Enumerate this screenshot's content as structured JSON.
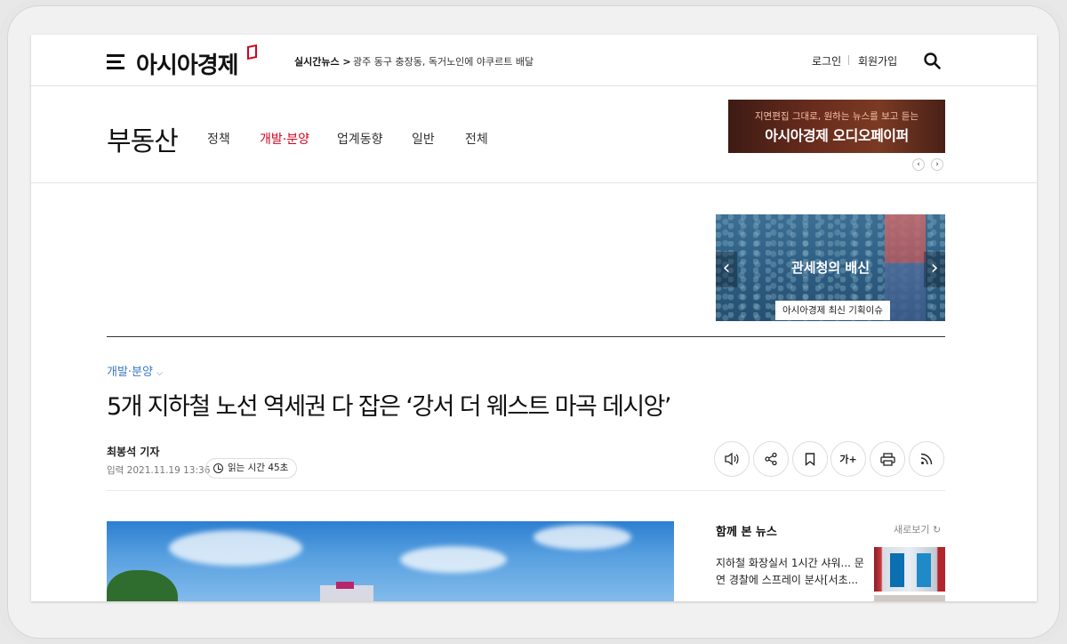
{
  "header": {
    "logo": "아시아경제",
    "live_label": "실시간뉴스 >",
    "live_headline": "광주 동구 충장동, 독거노인에 야쿠르트 배달",
    "login": "로그인",
    "signup": "회원가입"
  },
  "section": {
    "title": "부동산",
    "nav": [
      {
        "label": "정책"
      },
      {
        "label": "개발·분양"
      },
      {
        "label": "업계동향"
      },
      {
        "label": "일반"
      },
      {
        "label": "전체"
      }
    ],
    "active_nav": "개발·분양",
    "banner_sub": "지면편집 그대로, 원하는 뉴스를 보고 듣는",
    "banner_main": "아시아경제 오디오페이퍼"
  },
  "promo": {
    "title": "관세청의 배신",
    "caption": "아시아경제 최신 기획이슈"
  },
  "article": {
    "category": "개발·분양",
    "headline": "5개 지하철 노선 역세권 다 잡은 ‘강서 더 웨스트 마곡 데시앙’",
    "reporter": "최봉석 기자",
    "date": "입력 2021.11.19 13:36",
    "read_time": "읽는 시간 45초",
    "font_size_label": "가+",
    "tools": [
      "speaker-icon",
      "share-icon",
      "bookmark-icon",
      "font-size-button",
      "print-icon",
      "rss-icon"
    ]
  },
  "side_news": {
    "title": "함께 본 뉴스",
    "refresh": "새로보기",
    "item_text": "지하철 화장실서 1시간 샤워... 문 연 경찰에 스프레이 분사[서초..."
  },
  "colors": {
    "accent_red": "#d0021b",
    "category_blue": "#3a78c9"
  }
}
